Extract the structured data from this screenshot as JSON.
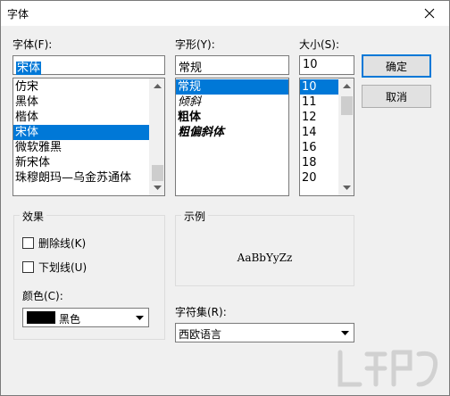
{
  "window": {
    "title": "字体"
  },
  "font": {
    "label": "字体(F):",
    "value": "宋体",
    "items": [
      "仿宋",
      "黑体",
      "楷体",
      "宋体",
      "微软雅黑",
      "新宋体",
      "珠穆朗玛—乌金苏通体"
    ],
    "selected_index": 3
  },
  "style": {
    "label": "字形(Y):",
    "value": "常规",
    "items": [
      "常规",
      "倾斜",
      "粗体",
      "粗偏斜体"
    ],
    "selected_index": 0
  },
  "size": {
    "label": "大小(S):",
    "value": "10",
    "items": [
      "10",
      "11",
      "12",
      "14",
      "16",
      "18",
      "20"
    ],
    "selected_index": 0
  },
  "buttons": {
    "ok": "确定",
    "cancel": "取消"
  },
  "effects": {
    "title": "效果",
    "strikeout": "删除线(K)",
    "underline": "下划线(U)",
    "color_label": "颜色(C):",
    "color_value": "黑色",
    "color_hex": "#000000"
  },
  "sample": {
    "title": "示例",
    "text": "AaBbYyZz"
  },
  "script": {
    "label": "字符集(R):",
    "value": "西欧语言"
  },
  "colors": {
    "selection": "#0078d7",
    "face": "#f0f0f0"
  }
}
